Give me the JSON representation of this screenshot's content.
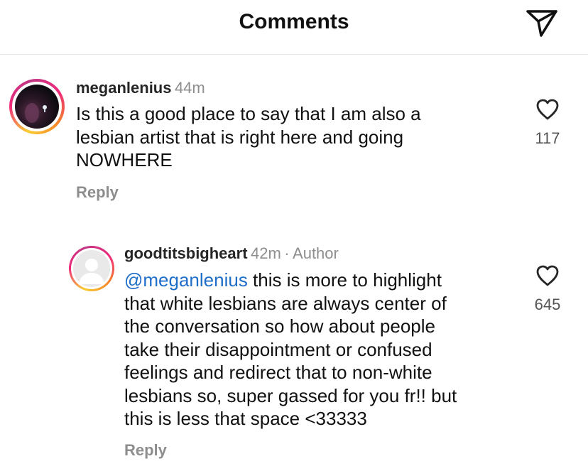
{
  "header": {
    "title": "Comments",
    "share_icon": "paper-plane-icon"
  },
  "colors": {
    "mention": "#1e6ec8",
    "muted": "#8e8e8e",
    "story_ring": [
      "#f9ce34",
      "#ee2a7b",
      "#c13584"
    ]
  },
  "comments": [
    {
      "username": "meganlenius",
      "time": "44m",
      "lines": [
        "Is this a good place to say that I am also a",
        "lesbian artist that is right here and going",
        "NOWHERE"
      ],
      "reply_label": "Reply",
      "like_count": "117",
      "like_icon": "heart-icon"
    }
  ],
  "replies": [
    {
      "username": "goodtitsbigheart",
      "time": "42m",
      "separator": "·",
      "badge": "Author",
      "mention": "@meganlenius",
      "first_line_rest": " this is more to highlight",
      "lines": [
        "that white lesbians are always center of",
        "the conversation so how about people",
        "take their disappointment or confused",
        "feelings and redirect that to non-white",
        "lesbians so, super gassed for you fr!! but",
        "this is less that space <33333"
      ],
      "reply_label": "Reply",
      "like_count": "645",
      "like_icon": "heart-icon"
    }
  ]
}
